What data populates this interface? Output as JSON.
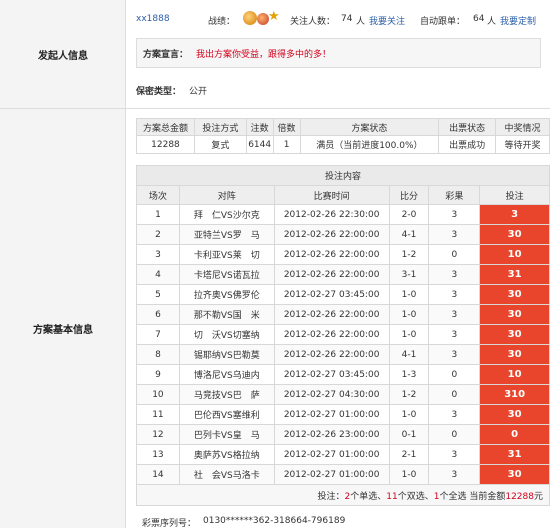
{
  "sections": {
    "initiator": "发起人信息",
    "basic": "方案基本信息"
  },
  "initiator": {
    "user": "xx1888",
    "record_label": "战绩：",
    "followers_label": "关注人数：",
    "followers_count": "74",
    "followers_unit": "人",
    "follow_link": "我要关注",
    "auto_label": "自动跟单：",
    "auto_count": "64",
    "auto_unit": "人",
    "custom_link": "我要定制"
  },
  "declaration": {
    "label": "方案宣言：",
    "text": "我出方案你受益，跟得多中的多！"
  },
  "privacy": {
    "label": "保密类型：",
    "value": "公开"
  },
  "summary": {
    "headers": [
      "方案总金额",
      "投注方式",
      "注数",
      "倍数",
      "方案状态",
      "出票状态",
      "中奖情况"
    ],
    "row": [
      "12288",
      "复式",
      "6144",
      "1",
      "满员（当前进度100.0%）",
      "出票成功",
      "等待开奖"
    ]
  },
  "bets": {
    "title": "投注内容",
    "headers": [
      "场次",
      "对阵",
      "比赛时间",
      "比分",
      "彩果",
      "投注"
    ],
    "rows": [
      [
        "1",
        "拜　仁VS沙尔克",
        "2012-02-26 22:30:00",
        "2-0",
        "3",
        "3"
      ],
      [
        "2",
        "亚特兰VS罗　马",
        "2012-02-26 22:00:00",
        "4-1",
        "3",
        "30"
      ],
      [
        "3",
        "卡利亚VS莱　切",
        "2012-02-26 22:00:00",
        "1-2",
        "0",
        "10"
      ],
      [
        "4",
        "卡塔尼VS诺瓦拉",
        "2012-02-26 22:00:00",
        "3-1",
        "3",
        "31"
      ],
      [
        "5",
        "拉齐奥VS佛罗伦",
        "2012-02-27 03:45:00",
        "1-0",
        "3",
        "30"
      ],
      [
        "6",
        "那不勒VS国　米",
        "2012-02-26 22:00:00",
        "1-0",
        "3",
        "30"
      ],
      [
        "7",
        "切　沃VS切塞纳",
        "2012-02-26 22:00:00",
        "1-0",
        "3",
        "30"
      ],
      [
        "8",
        "锡耶纳VS巴勒莫",
        "2012-02-26 22:00:00",
        "4-1",
        "3",
        "30"
      ],
      [
        "9",
        "博洛尼VS乌迪内",
        "2012-02-27 03:45:00",
        "1-3",
        "0",
        "10"
      ],
      [
        "10",
        "马竞技VS巴　萨",
        "2012-02-27 04:30:00",
        "1-2",
        "0",
        "310"
      ],
      [
        "11",
        "巴伦西VS塞维利",
        "2012-02-27 01:00:00",
        "1-0",
        "3",
        "30"
      ],
      [
        "12",
        "巴列卡VS皇　马",
        "2012-02-26 23:00:00",
        "0-1",
        "0",
        "0"
      ],
      [
        "13",
        "奥萨苏VS格拉纳",
        "2012-02-27 01:00:00",
        "2-1",
        "3",
        "31"
      ],
      [
        "14",
        "社　会VS马洛卡",
        "2012-02-27 01:00:00",
        "1-0",
        "3",
        "30"
      ]
    ],
    "footer": {
      "prefix": "投注：",
      "n1": "2",
      "t1": "个单选、",
      "n2": "11",
      "t2": "个双选、",
      "n3": "1",
      "t3": "个全选 当前金额",
      "amount": "12288",
      "unit": "元"
    }
  },
  "serial": {
    "label": "彩票序列号：",
    "value": "0130******362-318664-796189"
  },
  "colors": {
    "bet_highlight": "#e8452c",
    "link": "#2b5fa7",
    "declaration_text": "#d0021b"
  },
  "icons": [
    "trophy-icon",
    "medal-icon",
    "star-icon"
  ]
}
